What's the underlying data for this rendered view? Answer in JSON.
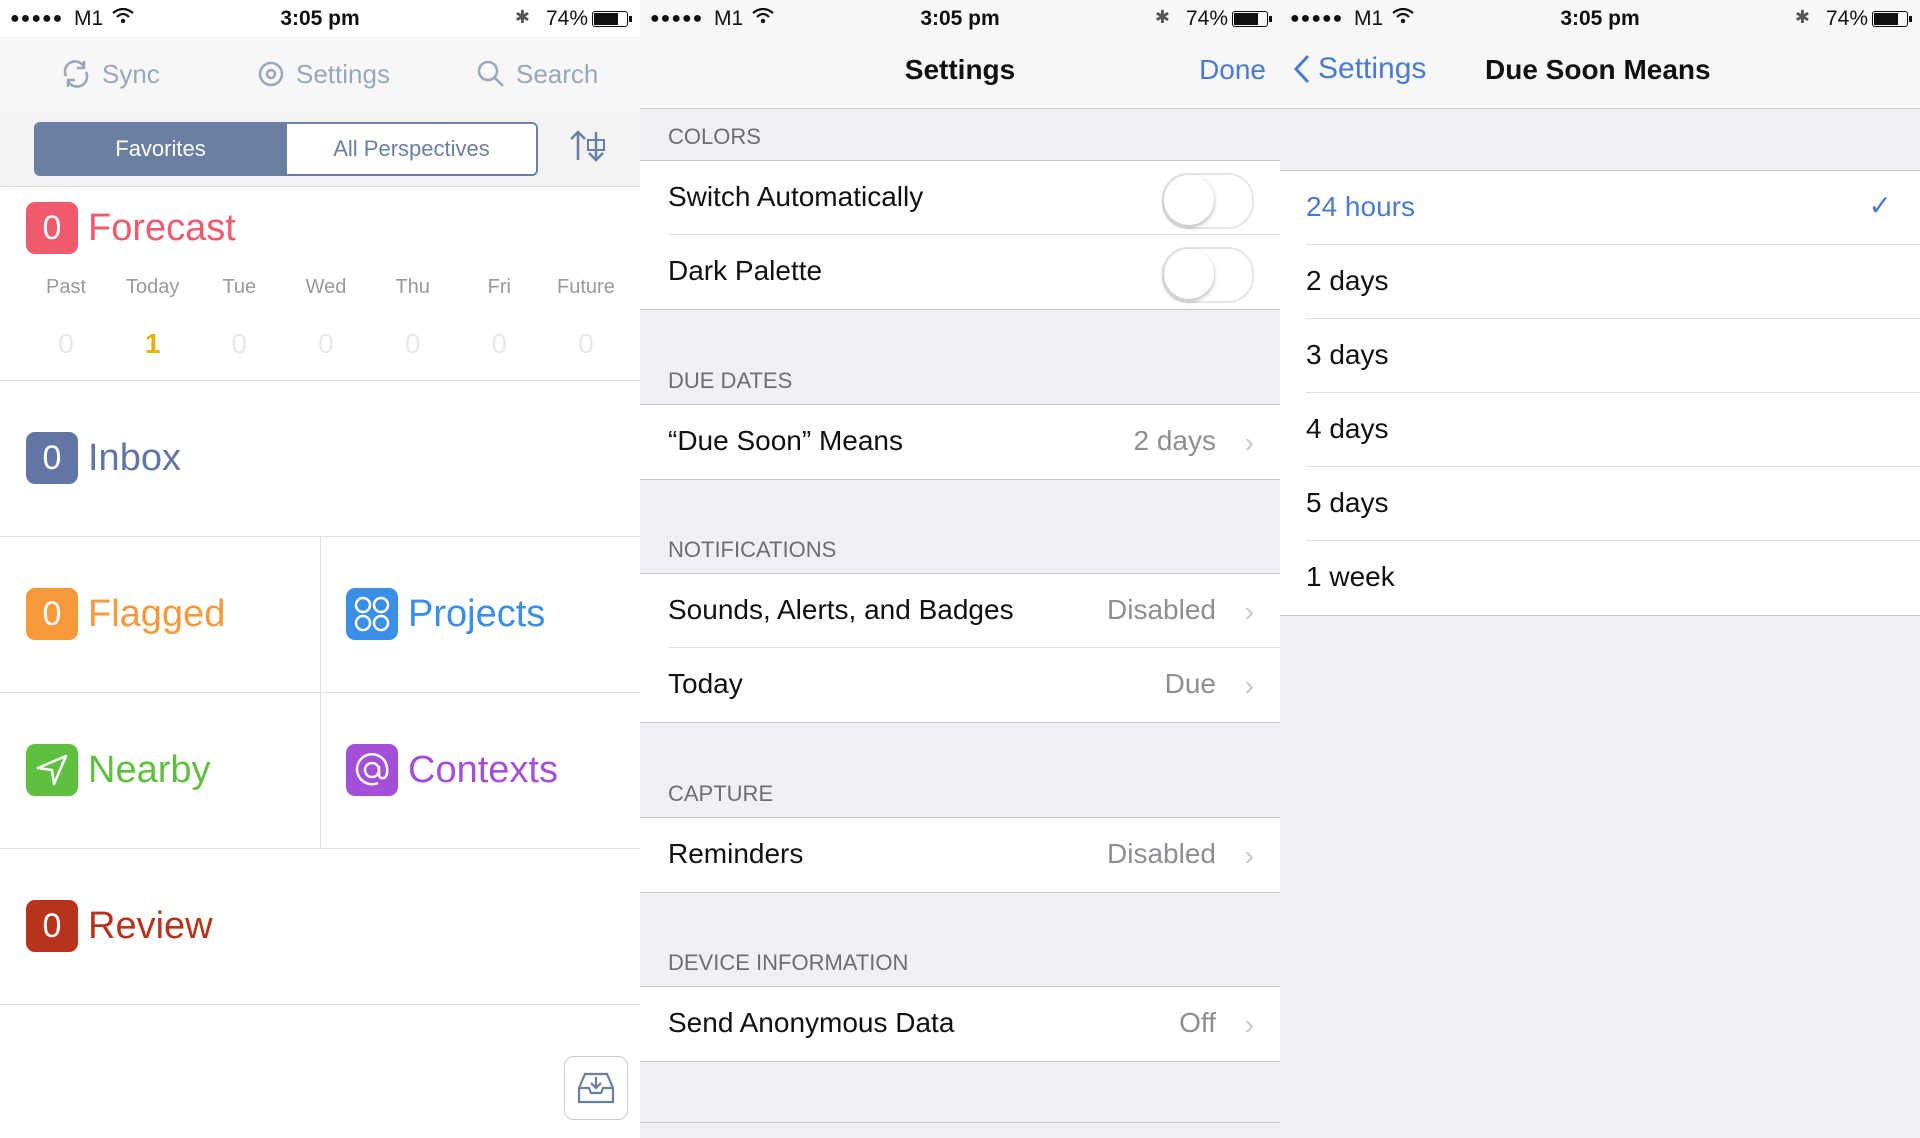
{
  "status": {
    "signal": "●●●●●",
    "carrier": "M1",
    "time": "3:05 pm",
    "bluetooth": "✱",
    "battery": "74%"
  },
  "omnifocus": {
    "toolbar": {
      "sync": "Sync",
      "settings": "Settings",
      "search": "Search"
    },
    "segment": {
      "favorites": "Favorites",
      "all": "All Perspectives"
    },
    "forecast": {
      "count": "0",
      "title": "Forecast",
      "color": "#f05a6e",
      "days": [
        "Past",
        "Today",
        "Tue",
        "Wed",
        "Thu",
        "Fri",
        "Future"
      ],
      "counts": [
        "0",
        "1",
        "0",
        "0",
        "0",
        "0",
        "0"
      ]
    },
    "inbox": {
      "count": "0",
      "title": "Inbox",
      "color": "#6176a4"
    },
    "flagged": {
      "count": "0",
      "title": "Flagged",
      "color": "#f7993b"
    },
    "projects": {
      "title": "Projects",
      "color": "#3a8ee6"
    },
    "nearby": {
      "title": "Nearby",
      "color": "#5fc040"
    },
    "contexts": {
      "title": "Contexts",
      "color": "#a34fd8"
    },
    "review": {
      "count": "0",
      "title": "Review",
      "color": "#b8331c"
    }
  },
  "settings": {
    "title": "Settings",
    "done": "Done",
    "colors_header": "COLORS",
    "switch_auto": "Switch Automatically",
    "dark_palette": "Dark Palette",
    "due_header": "DUE DATES",
    "due_soon": "“Due Soon” Means",
    "due_soon_value": "2 days",
    "notif_header": "NOTIFICATIONS",
    "sounds": "Sounds, Alerts, and Badges",
    "sounds_value": "Disabled",
    "today": "Today",
    "today_value": "Due",
    "capture_header": "CAPTURE",
    "reminders": "Reminders",
    "reminders_value": "Disabled",
    "device_header": "DEVICE INFORMATION",
    "anon": "Send Anonymous Data",
    "anon_value": "Off"
  },
  "due_soon": {
    "back": "Settings",
    "title": "Due Soon Means",
    "options": [
      "24 hours",
      "2 days",
      "3 days",
      "4 days",
      "5 days",
      "1 week"
    ],
    "selected": "24 hours"
  }
}
